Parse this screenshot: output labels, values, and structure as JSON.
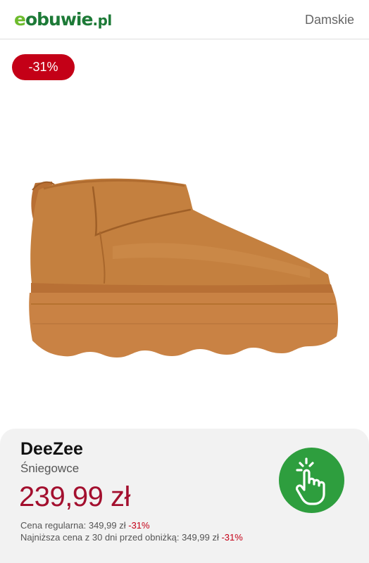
{
  "header": {
    "logo": {
      "e": "e",
      "main": "obuwie",
      "tld": ".pl"
    },
    "nav_link": "Damskie"
  },
  "product": {
    "discount_badge": "-31%",
    "image_icon": "ugg-style-platform-boot",
    "brand": "DeeZee",
    "category": "Śniegowce",
    "price": "239,99 zł",
    "regular_price_label": "Cena regularna: 349,99 zł",
    "regular_price_pct": "-31%",
    "lowest_price_label": "Najniższa cena z 30 dni przed obniżką: 349,99 zł",
    "lowest_price_pct": "-31%"
  },
  "cta": {
    "icon": "tap-hand-icon"
  },
  "colors": {
    "brand_green": "#1d7a37",
    "accent_green": "#6dbb2d",
    "sale_red": "#c40017",
    "price_red": "#a30f2e",
    "cta_green": "#2e9e3e",
    "boot_tan": "#c4803f"
  }
}
